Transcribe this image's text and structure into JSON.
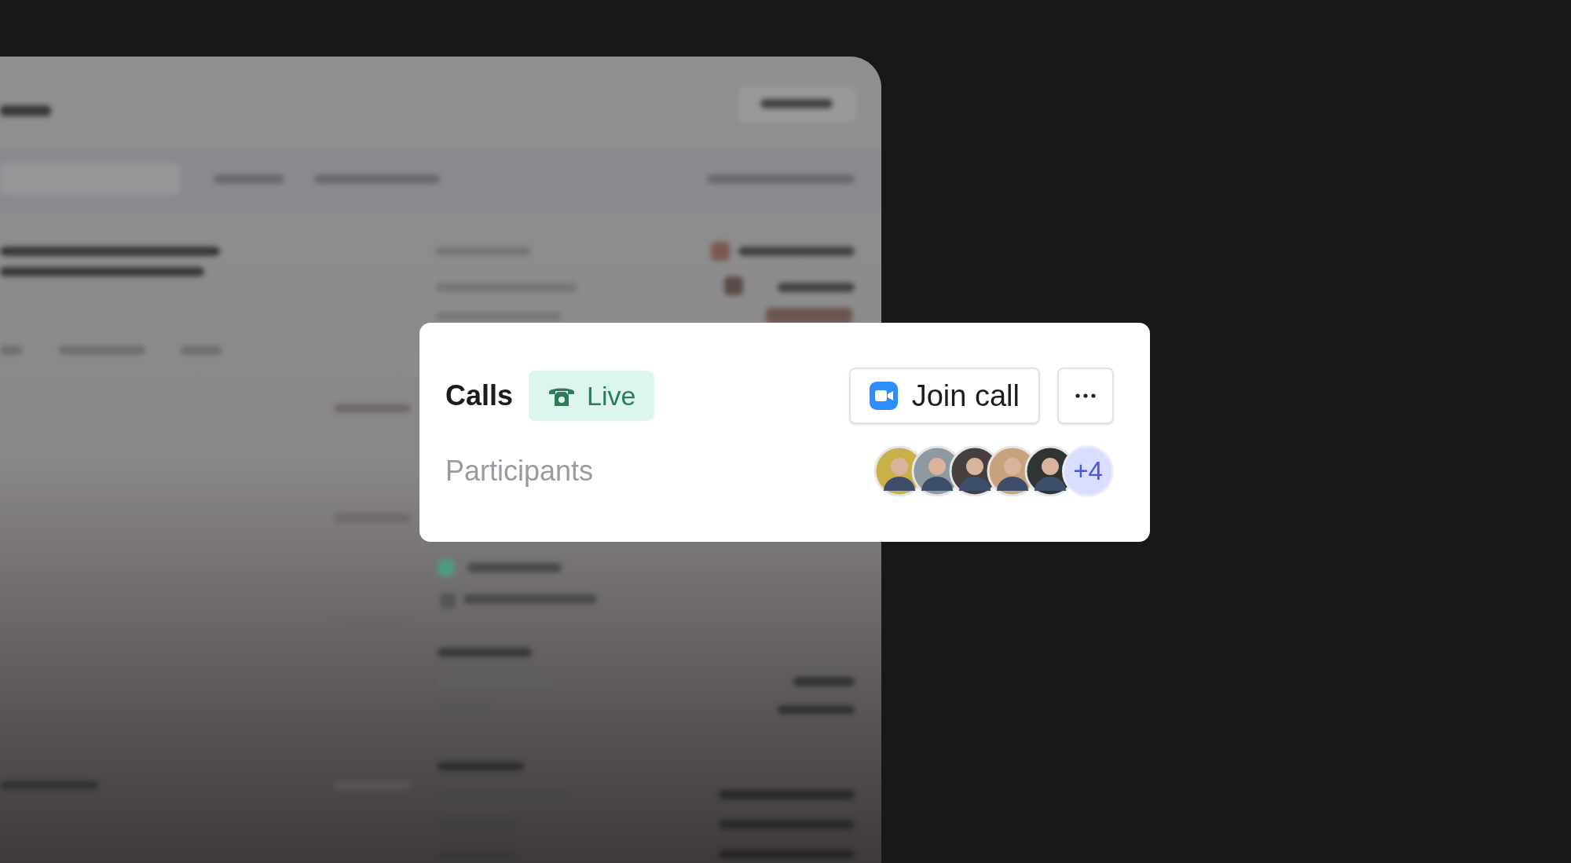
{
  "calls_card": {
    "title": "Calls",
    "status": {
      "kind": "live",
      "label": "Live"
    },
    "join_button": "Join call",
    "participants_label": "Participants",
    "avatars": [
      {
        "kind": "photo"
      },
      {
        "kind": "photo"
      },
      {
        "kind": "photo"
      },
      {
        "kind": "photo"
      },
      {
        "kind": "photo"
      }
    ],
    "overflow_count": "+4"
  }
}
